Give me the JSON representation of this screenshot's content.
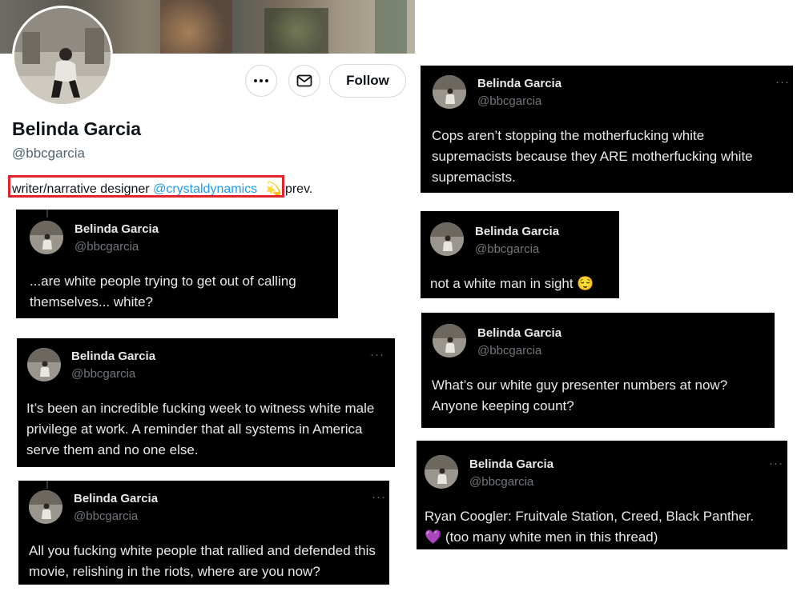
{
  "profile": {
    "name": "Belinda Garcia",
    "handle": "@bbcgarcia",
    "bio_prefix": "writer/narrative designer ",
    "bio_mention": "@crystaldynamics",
    "bio_emoji": "💫",
    "bio_suffix": "prev.",
    "follow_label": "Follow",
    "more_icon": "more-icon",
    "message_icon": "envelope-icon"
  },
  "tweets": [
    {
      "name": "Belinda Garcia",
      "handle": "@bbcgarcia",
      "text": "...are white people trying to get out of calling themselves... white?"
    },
    {
      "name": "Belinda Garcia",
      "handle": "@bbcgarcia",
      "text": "It’s been an incredible fucking week to witness white male privilege at work. A reminder that all systems in America serve them and no one else."
    },
    {
      "name": "Belinda Garcia",
      "handle": "@bbcgarcia",
      "text": "All you fucking white people that rallied and defended this movie, relishing in the riots, where are you now?"
    },
    {
      "name": "Belinda Garcia",
      "handle": "@bbcgarcia",
      "text": "Cops aren’t stopping the motherfucking white supremacists because they ARE motherfucking white supremacists."
    },
    {
      "name": "Belinda Garcia",
      "handle": "@bbcgarcia",
      "text": "not a white man in sight",
      "emoji": "😌"
    },
    {
      "name": "Belinda Garcia",
      "handle": "@bbcgarcia",
      "text": "What’s our white guy presenter numbers at now? Anyone keeping count?"
    },
    {
      "name": "Belinda Garcia",
      "handle": "@bbcgarcia",
      "text_line1": "Ryan Coogler: Fruitvale Station, Creed, Black Panther.",
      "emoji": "💜",
      "text_line2": "(too many white men in this thread)"
    }
  ],
  "more_glyph": "···"
}
